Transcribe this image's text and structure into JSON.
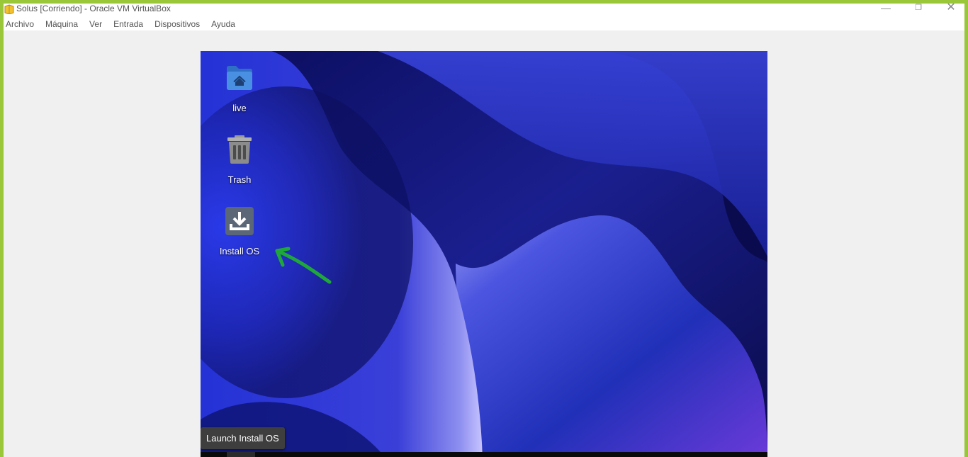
{
  "window": {
    "title": "Solus [Corriendo] - Oracle VM VirtualBox",
    "controls": {
      "minimize": "—",
      "maximize": "❐",
      "close": "✕"
    }
  },
  "menubar": {
    "items": [
      "Archivo",
      "Máquina",
      "Ver",
      "Entrada",
      "Dispositivos",
      "Ayuda"
    ]
  },
  "desktop": {
    "icons": [
      {
        "label": "live",
        "icon": "home-folder-icon"
      },
      {
        "label": "Trash",
        "icon": "trash-icon"
      },
      {
        "label": "Install OS",
        "icon": "install-download-icon"
      }
    ],
    "tooltip": "Launch Install OS"
  },
  "colors": {
    "border_accent": "#9ac63a",
    "annotation_arrow": "#1fa83a",
    "folder_blue": "#3f86d8",
    "tooltip_bg": "#3e3e3e"
  }
}
